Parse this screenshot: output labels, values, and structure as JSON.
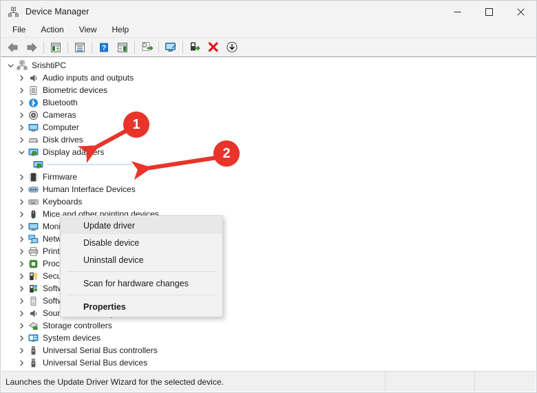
{
  "window": {
    "title": "Device Manager",
    "icon": "device-manager-icon",
    "controls": {
      "minimize": "─",
      "maximize": "□",
      "close": "✕"
    }
  },
  "menubar": {
    "items": [
      {
        "label": "File"
      },
      {
        "label": "Action"
      },
      {
        "label": "View"
      },
      {
        "label": "Help"
      }
    ]
  },
  "toolbar": {
    "buttons": [
      {
        "name": "back-icon"
      },
      {
        "name": "forward-icon"
      },
      {
        "name": "show-hide-console-tree-icon"
      },
      {
        "name": "properties-icon"
      },
      {
        "name": "help-icon"
      },
      {
        "name": "show-hide-action-pane-icon"
      },
      {
        "name": "update-driver-icon"
      },
      {
        "name": "scan-for-hardware-changes-icon"
      },
      {
        "name": "enable-device-icon"
      },
      {
        "name": "uninstall-device-icon"
      },
      {
        "name": "disable-device-icon"
      }
    ]
  },
  "tree": {
    "root": {
      "label": "SrishtiPC",
      "icon": "computer-root-icon",
      "expanded": true
    },
    "items": [
      {
        "label": "Audio inputs and outputs",
        "icon": "speaker-icon",
        "expanded": false
      },
      {
        "label": "Biometric devices",
        "icon": "fingerprint-icon",
        "expanded": false
      },
      {
        "label": "Bluetooth",
        "icon": "bluetooth-icon",
        "expanded": false
      },
      {
        "label": "Cameras",
        "icon": "camera-icon",
        "expanded": false
      },
      {
        "label": "Computer",
        "icon": "monitor-icon",
        "expanded": false
      },
      {
        "label": "Disk drives",
        "icon": "disk-drive-icon",
        "expanded": false
      },
      {
        "label": "Display adapters",
        "icon": "display-adapter-icon",
        "expanded": true
      },
      {
        "label": "Firmware",
        "icon": "firmware-chip-icon",
        "expanded": false
      },
      {
        "label": "Human Interface Devices",
        "icon": "hid-icon",
        "expanded": false
      },
      {
        "label": "Keyboards",
        "icon": "keyboard-icon",
        "expanded": false
      },
      {
        "label": "Mice and other pointing devices",
        "icon": "mouse-icon",
        "expanded": false
      },
      {
        "label": "Monitors",
        "icon": "monitor-icon",
        "expanded": false
      },
      {
        "label": "Network adapters",
        "icon": "network-adapter-icon",
        "expanded": false
      },
      {
        "label": "Print queues",
        "icon": "printer-icon",
        "expanded": false
      },
      {
        "label": "Processors",
        "icon": "processor-icon",
        "expanded": false
      },
      {
        "label": "Security devices",
        "icon": "security-device-icon",
        "expanded": false
      },
      {
        "label": "Software components",
        "icon": "software-component-icon",
        "expanded": false
      },
      {
        "label": "Software devices",
        "icon": "software-device-icon",
        "expanded": false
      },
      {
        "label": "Sound, video and game controllers",
        "icon": "speaker-icon",
        "expanded": false
      },
      {
        "label": "Storage controllers",
        "icon": "storage-controller-icon",
        "expanded": false
      },
      {
        "label": "System devices",
        "icon": "system-device-icon",
        "expanded": false
      },
      {
        "label": "Universal Serial Bus controllers",
        "icon": "usb-icon",
        "expanded": false
      },
      {
        "label": "Universal Serial Bus devices",
        "icon": "usb-icon",
        "expanded": false
      }
    ],
    "selected_child": {
      "label": "",
      "icon": "display-adapter-icon",
      "parent": "Display adapters",
      "selected": true
    }
  },
  "context_menu": {
    "items": [
      {
        "label": "Update driver",
        "highlighted": true,
        "bold": false
      },
      {
        "label": "Disable device",
        "highlighted": false,
        "bold": false
      },
      {
        "label": "Uninstall device",
        "highlighted": false,
        "bold": false
      },
      {
        "separator": true
      },
      {
        "label": "Scan for hardware changes",
        "highlighted": false,
        "bold": false
      },
      {
        "separator": true
      },
      {
        "label": "Properties",
        "highlighted": false,
        "bold": true
      }
    ]
  },
  "annotations": {
    "color": "#e8342a",
    "badges": [
      {
        "number": "1",
        "points_to": "Display adapters"
      },
      {
        "number": "2",
        "points_to": "Update driver"
      }
    ]
  },
  "statusbar": {
    "message": "Launches the Update Driver Wizard for the selected device.",
    "pane2": "",
    "pane3": ""
  }
}
